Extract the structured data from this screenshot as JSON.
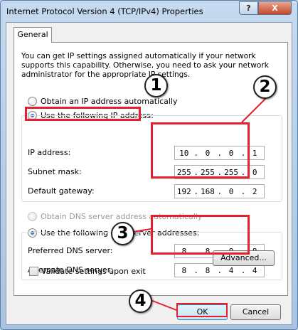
{
  "window": {
    "title": "Internet Protocol Version 4 (TCP/IPv4) Properties",
    "help_glyph": "?",
    "close_glyph": "X"
  },
  "tabs": [
    {
      "label": "General"
    }
  ],
  "info_text": "You can get IP settings assigned automatically if your network supports this capability. Otherwise, you need to ask your network administrator for the appropriate IP settings.",
  "ip_section": {
    "auto_label": "Obtain an IP address automatically",
    "manual_label": "Use the following IP address:",
    "fields": [
      {
        "label": "IP address:",
        "octets": [
          "10",
          "0",
          "0",
          "1"
        ]
      },
      {
        "label": "Subnet mask:",
        "octets": [
          "255",
          "255",
          "255",
          "0"
        ]
      },
      {
        "label": "Default gateway:",
        "octets": [
          "192",
          "168",
          "0",
          "2"
        ]
      }
    ]
  },
  "dns_section": {
    "auto_label": "Obtain DNS server address automatically",
    "manual_label": "Use the following DNS server addresses:",
    "fields": [
      {
        "label": "Preferred DNS server:",
        "octets": [
          "8",
          "8",
          "8",
          "8"
        ]
      },
      {
        "label": "Alternate DNS server:",
        "octets": [
          "8",
          "8",
          "4",
          "4"
        ]
      }
    ]
  },
  "validate_label": "Validate settings upon exit",
  "buttons": {
    "advanced": "Advanced...",
    "ok": "OK",
    "cancel": "Cancel"
  },
  "callouts": [
    "1",
    "2",
    "3",
    "4"
  ],
  "colors": {
    "highlight": "#e4202e",
    "dialog_bg": "#f0f0f0",
    "title_bar": "#c5daf0"
  }
}
